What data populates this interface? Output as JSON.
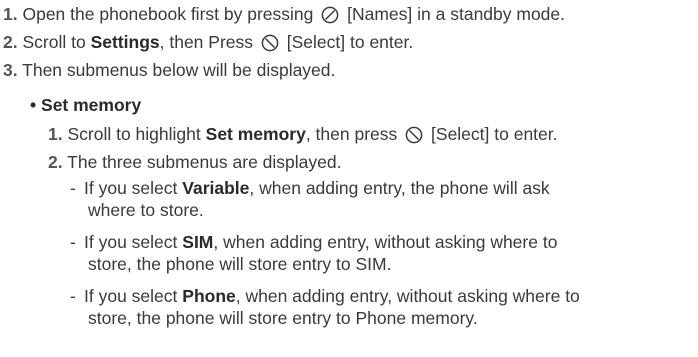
{
  "steps": [
    {
      "num": "1.",
      "text_a": "Open the phonebook first by pressing",
      "icon": "left-soft-key-icon",
      "text_b": "[Names] in a standby mode."
    },
    {
      "num": "2.",
      "text_a": "Scroll to",
      "bold": "Settings",
      "text_b": ", then Press",
      "icon": "right-soft-key-icon",
      "text_c": "[Select] to enter."
    },
    {
      "num": "3.",
      "text": "Then submenus below will be displayed."
    }
  ],
  "section": {
    "bullet": "•",
    "title": "Set memory",
    "substeps": [
      {
        "num": "1.",
        "text_a": "Scroll to highlight",
        "bold": "Set memory",
        "text_b": ", then press",
        "icon": "right-soft-key-icon",
        "text_c": "[Select] to enter."
      },
      {
        "num": "2.",
        "text": "The three submenus are displayed."
      }
    ],
    "options": [
      {
        "dash": "-",
        "prefix": "If you select",
        "bold": "Variable",
        "line1_rest": ", when adding entry, the phone will ask",
        "line2": "where to store."
      },
      {
        "dash": "-",
        "prefix": "If you select",
        "bold": "SIM",
        "line1_rest": ", when adding entry, without asking where to",
        "line2": "store, the phone will store entry to SIM."
      },
      {
        "dash": "-",
        "prefix": "If you select",
        "bold": "Phone",
        "line1_rest": ", when adding entry, without asking where to",
        "line2": "store, the phone will store entry to Phone memory."
      }
    ]
  }
}
